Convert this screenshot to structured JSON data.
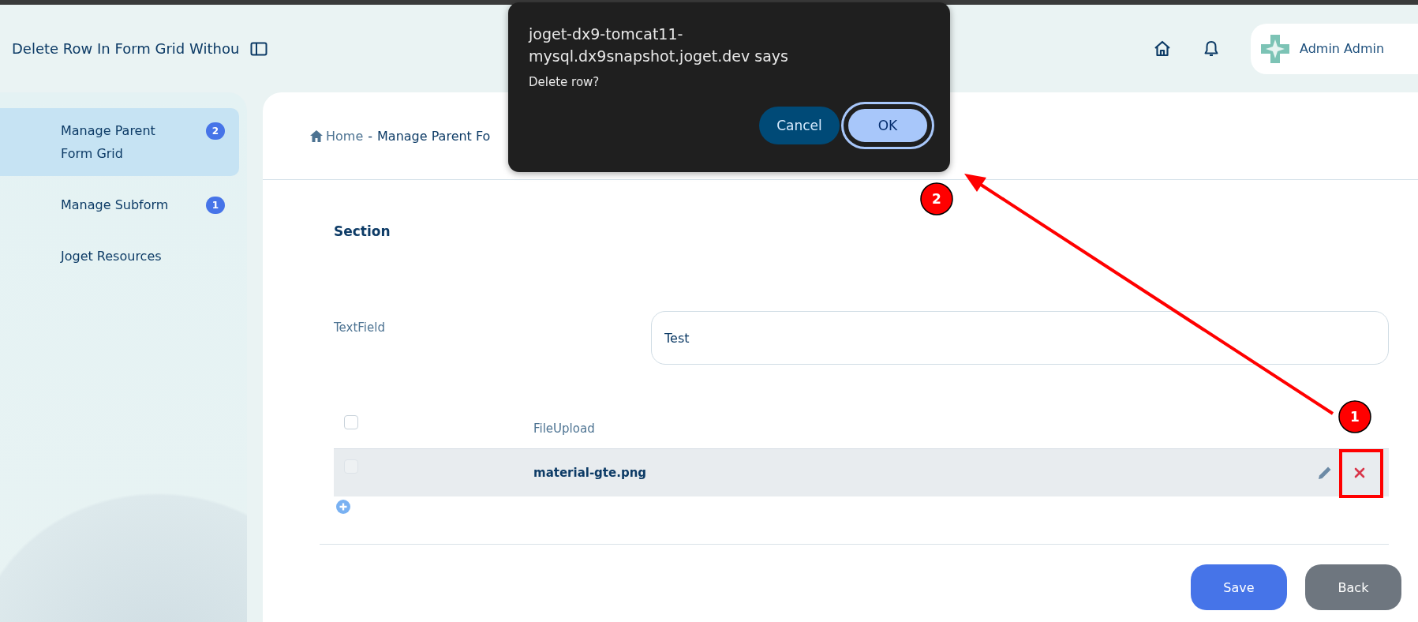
{
  "top_bar": {
    "title": "Delete Row In Form Grid Withou",
    "user": "Admin Admin"
  },
  "sidebar": {
    "items": [
      {
        "label": "Manage Parent Form Grid",
        "badge": "2",
        "selected": true
      },
      {
        "label": "Manage Subform",
        "badge": "1",
        "selected": false
      },
      {
        "label": "Joget Resources",
        "selected": false
      }
    ]
  },
  "breadcrumb": {
    "home": "Home",
    "separator": "-",
    "current": "Manage Parent Fo"
  },
  "form": {
    "section": "Section",
    "fields": [
      {
        "label": "TextField",
        "value": "Test"
      }
    ],
    "grid": {
      "columns": [
        "FileUpload"
      ],
      "header_checked": false,
      "rows": [
        {
          "file": "material-gte.png",
          "checked": false
        }
      ]
    }
  },
  "buttons": [
    {
      "label": "Save",
      "kind": "primary"
    },
    {
      "label": "Back",
      "kind": "secondary"
    }
  ],
  "dialog": {
    "title": "joget-dx9-tomcat11-mysql.dx9snapshot.joget.dev says",
    "message": "Delete row?",
    "buttons": [
      {
        "label": "Cancel",
        "selected": false
      },
      {
        "label": "OK",
        "selected": true
      }
    ]
  },
  "annotations": [
    {
      "number": "1"
    },
    {
      "number": "2"
    }
  ]
}
